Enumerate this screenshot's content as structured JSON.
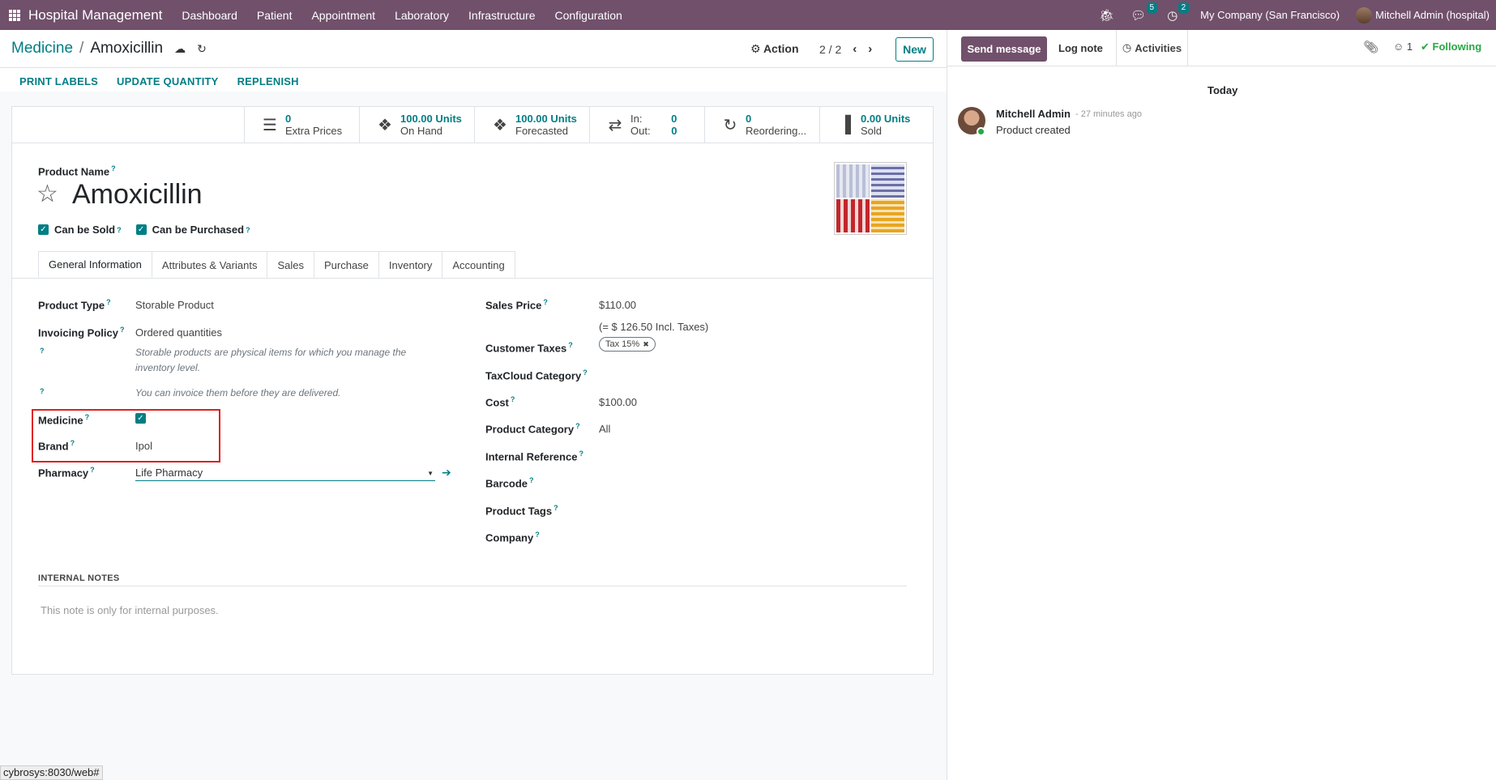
{
  "topbar": {
    "app_title": "Hospital Management",
    "menu": [
      "Dashboard",
      "Patient",
      "Appointment",
      "Laboratory",
      "Infrastructure",
      "Configuration"
    ],
    "messages_count": "5",
    "activities_count": "2",
    "company": "My Company (San Francisco)",
    "user": "Mitchell Admin (hospital)"
  },
  "breadcrumb": {
    "parent": "Medicine",
    "separator": "/",
    "current": "Amoxicillin"
  },
  "control": {
    "action_label": "Action",
    "pager": "2 / 2",
    "new_label": "New"
  },
  "status_buttons": [
    "PRINT LABELS",
    "UPDATE QUANTITY",
    "REPLENISH"
  ],
  "smart_buttons": [
    {
      "icon": "list-icon",
      "value": "0",
      "label": "Extra Prices"
    },
    {
      "icon": "cubes-icon",
      "value": "100.00 Units",
      "label": "On Hand"
    },
    {
      "icon": "cubes-icon",
      "value": "100.00 Units",
      "label": "Forecasted"
    },
    {
      "icon": "exchange-icon",
      "in_label": "In:",
      "in_value": "0",
      "out_label": "Out:",
      "out_value": "0"
    },
    {
      "icon": "refresh-icon",
      "value": "0",
      "label": "Reordering..."
    },
    {
      "icon": "bar-chart-icon",
      "value": "0.00 Units",
      "label": "Sold"
    }
  ],
  "product": {
    "name_label": "Product Name",
    "name": "Amoxicillin",
    "can_be_sold_label": "Can be Sold",
    "can_be_purchased_label": "Can be Purchased",
    "can_be_sold": true,
    "can_be_purchased": true
  },
  "tabs": [
    "General Information",
    "Attributes & Variants",
    "Sales",
    "Purchase",
    "Inventory",
    "Accounting"
  ],
  "left_fields": {
    "product_type_label": "Product Type",
    "product_type": "Storable Product",
    "invoicing_policy_label": "Invoicing Policy",
    "invoicing_policy": "Ordered quantities",
    "help_1": "Storable products are physical items for which you manage the inventory level.",
    "help_2": "You can invoice them before they are delivered.",
    "medicine_label": "Medicine",
    "medicine": true,
    "brand_label": "Brand",
    "brand": "Ipol",
    "pharmacy_label": "Pharmacy",
    "pharmacy": "Life Pharmacy"
  },
  "right_fields": {
    "sales_price_label": "Sales Price",
    "sales_price": "$110.00",
    "sales_price_incl": "(= $ 126.50 Incl. Taxes)",
    "customer_taxes_label": "Customer Taxes",
    "customer_tax_tag": "Tax 15%",
    "taxcloud_label": "TaxCloud Category",
    "cost_label": "Cost",
    "cost": "$100.00",
    "category_label": "Product Category",
    "category": "All",
    "internal_ref_label": "Internal Reference",
    "barcode_label": "Barcode",
    "tags_label": "Product Tags",
    "company_label": "Company"
  },
  "notes": {
    "label": "INTERNAL NOTES",
    "placeholder": "This note is only for internal purposes."
  },
  "chatter": {
    "send_message": "Send message",
    "log_note": "Log note",
    "activities": "Activities",
    "followers": "1",
    "following": "Following",
    "date_separator": "Today",
    "message": {
      "author": "Mitchell Admin",
      "time": "- 27 minutes ago",
      "body": "Product created"
    }
  },
  "status_url": "cybrosys:8030/web#",
  "colors": {
    "brand": "#71506b",
    "accent": "#017e84",
    "highlight": "#e02020"
  }
}
